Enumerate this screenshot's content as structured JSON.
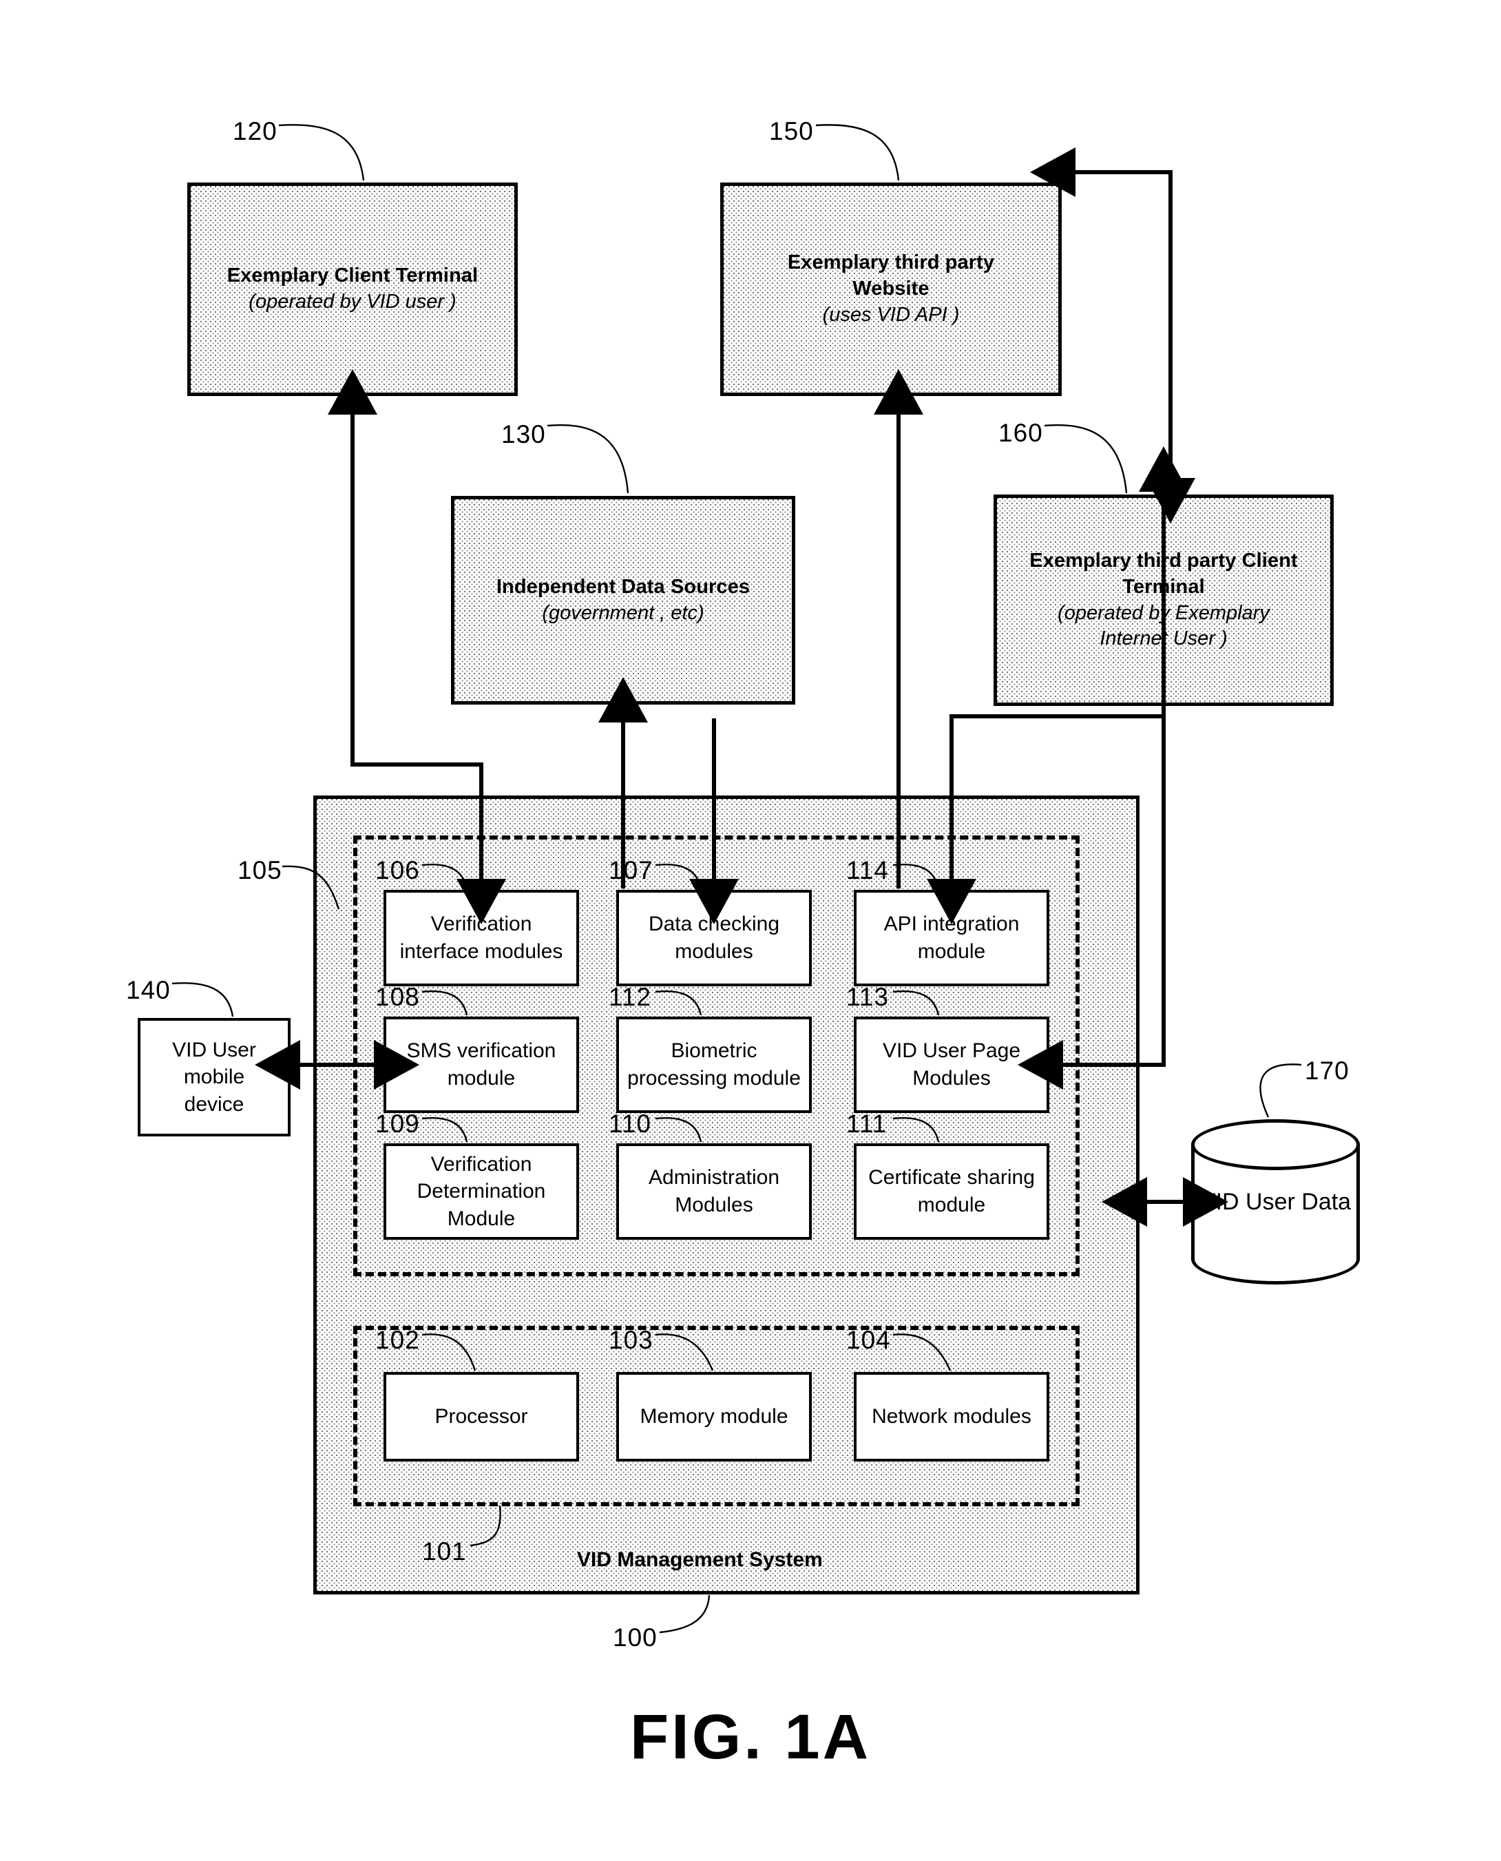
{
  "figure": {
    "caption": "FIG. 1A"
  },
  "entities": {
    "client_terminal": {
      "ref": "120",
      "title": "Exemplary Client Terminal",
      "subtitle": "(operated by VID user )"
    },
    "third_party_website": {
      "ref": "150",
      "title_line1": "Exemplary third party",
      "title_line2": "Website",
      "subtitle": "(uses VID API )"
    },
    "independent_data_sources": {
      "ref": "130",
      "title": "Independent Data Sources",
      "subtitle": "(government , etc)"
    },
    "third_party_client_terminal": {
      "ref": "160",
      "title_line1": "Exemplary third party Client",
      "title_line2": "Terminal",
      "subtitle_line1": "(operated by Exemplary",
      "subtitle_line2": "Internet User )"
    },
    "mobile_device": {
      "ref": "140",
      "label_line1": "VID User",
      "label_line2": "mobile",
      "label_line3": "device"
    },
    "user_data_store": {
      "ref": "170",
      "label": "VID User Data"
    }
  },
  "system": {
    "ref": "100",
    "label": "VID Management System",
    "modules_group_ref": "105",
    "hardware_group_ref": "101",
    "modules": [
      {
        "ref": "106",
        "label": "Verification interface modules"
      },
      {
        "ref": "107",
        "label": "Data checking modules"
      },
      {
        "ref": "114",
        "label": "API integration module"
      },
      {
        "ref": "108",
        "label": "SMS verification module"
      },
      {
        "ref": "112",
        "label": "Biometric processing module"
      },
      {
        "ref": "113",
        "label": "VID User Page Modules"
      },
      {
        "ref": "109",
        "label": "Verification Determination Module"
      },
      {
        "ref": "110",
        "label": "Administration Modules"
      },
      {
        "ref": "111",
        "label": "Certificate sharing module"
      }
    ],
    "hardware": [
      {
        "ref": "102",
        "label": "Processor"
      },
      {
        "ref": "103",
        "label": "Memory module"
      },
      {
        "ref": "104",
        "label": "Network modules"
      }
    ]
  },
  "colors": {
    "ink": "#000000",
    "fill": "#fbfbfb",
    "page": "#ffffff"
  }
}
